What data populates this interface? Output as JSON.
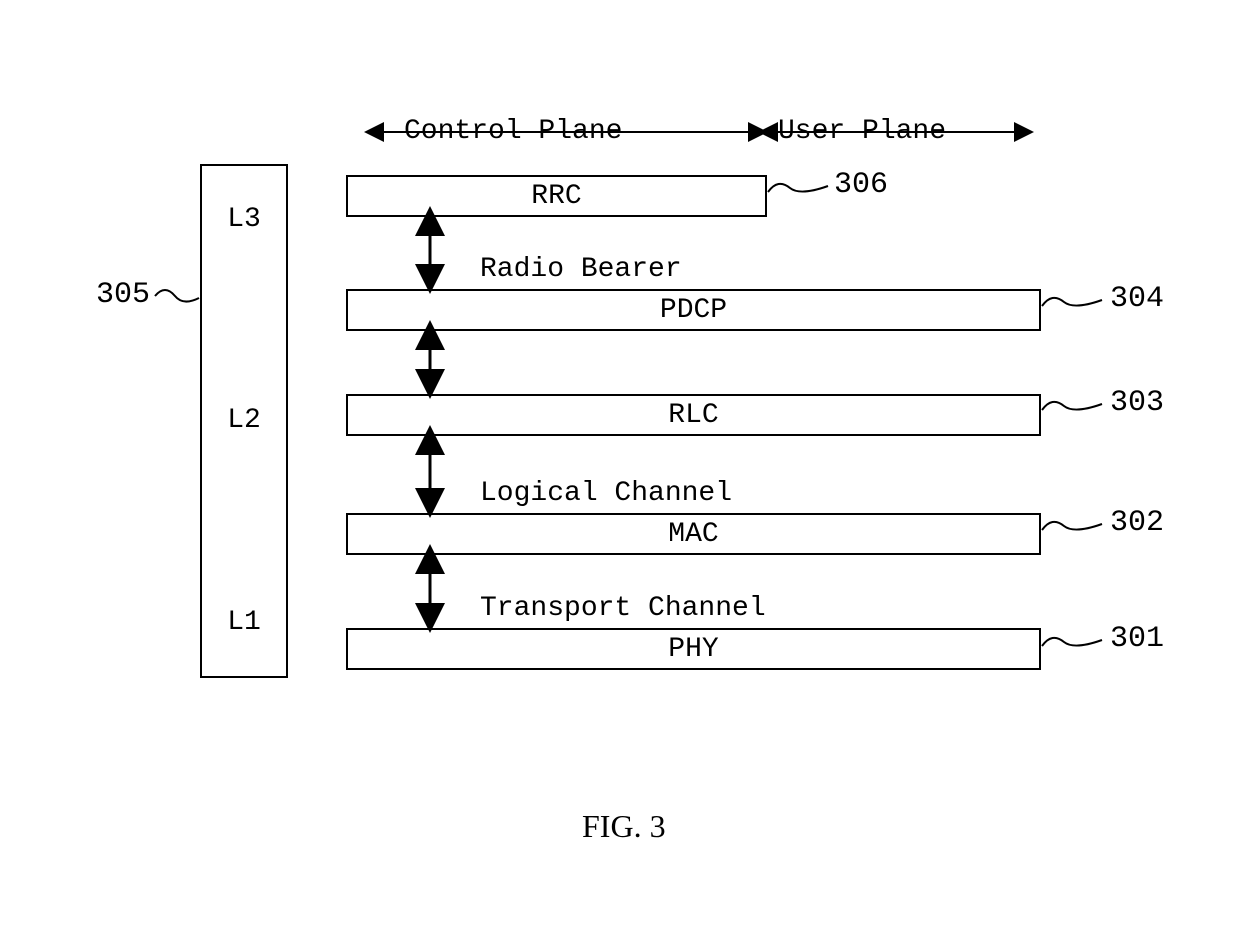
{
  "planes": {
    "control": "Control Plane",
    "user": "User Plane"
  },
  "layerColumn": {
    "L3": "L3",
    "L2": "L2",
    "L1": "L1"
  },
  "stack": {
    "rrc": "RRC",
    "pdcp": "PDCP",
    "rlc": "RLC",
    "mac": "MAC",
    "phy": "PHY"
  },
  "interfaces": {
    "radioBearer": "Radio Bearer",
    "logicalChannel": "Logical Channel",
    "transportChannel": "Transport Channel"
  },
  "refs": {
    "r301": "301",
    "r302": "302",
    "r303": "303",
    "r304": "304",
    "r305": "305",
    "r306": "306"
  },
  "figure": "FIG. 3"
}
